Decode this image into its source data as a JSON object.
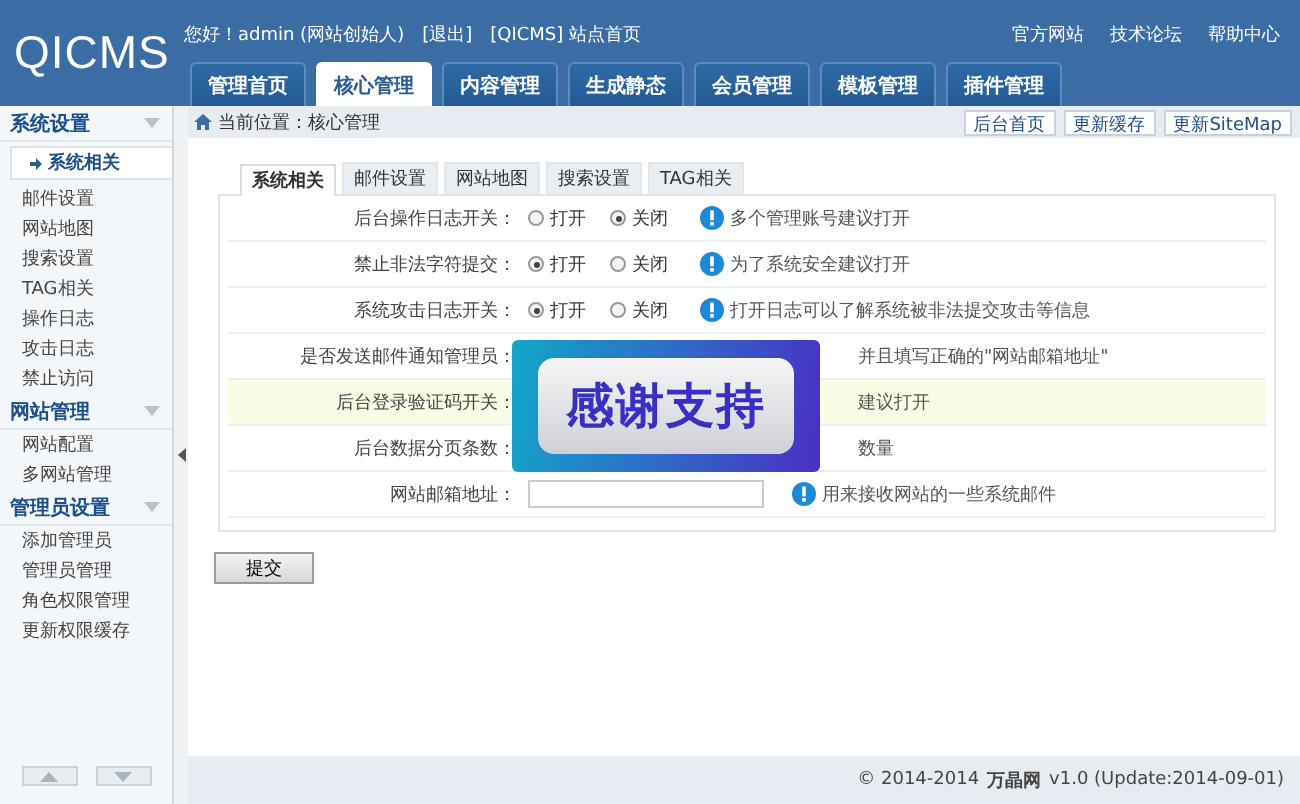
{
  "logo": "QICMS",
  "user_bar": {
    "greeting": "您好！admin (网站创始人)",
    "logout": "[退出]",
    "site_home": "[QICMS] 站点首页"
  },
  "top_links": [
    "官方网站",
    "技术论坛",
    "帮助中心"
  ],
  "nav_tabs": [
    {
      "label": "管理首页",
      "selected": false
    },
    {
      "label": "核心管理",
      "selected": true
    },
    {
      "label": "内容管理",
      "selected": false
    },
    {
      "label": "生成静态",
      "selected": false
    },
    {
      "label": "会员管理",
      "selected": false
    },
    {
      "label": "模板管理",
      "selected": false
    },
    {
      "label": "插件管理",
      "selected": false
    }
  ],
  "sidebar": {
    "sections": [
      {
        "title": "系统设置",
        "items": [
          {
            "label": "系统相关",
            "selected": true
          },
          {
            "label": "邮件设置",
            "selected": false
          },
          {
            "label": "网站地图",
            "selected": false
          },
          {
            "label": "搜索设置",
            "selected": false
          },
          {
            "label": "TAG相关",
            "selected": false
          },
          {
            "label": "操作日志",
            "selected": false
          },
          {
            "label": "攻击日志",
            "selected": false
          },
          {
            "label": "禁止访问",
            "selected": false
          }
        ]
      },
      {
        "title": "网站管理",
        "items": [
          {
            "label": "网站配置",
            "selected": false
          },
          {
            "label": "多网站管理",
            "selected": false
          }
        ]
      },
      {
        "title": "管理员设置",
        "items": [
          {
            "label": "添加管理员",
            "selected": false
          },
          {
            "label": "管理员管理",
            "selected": false
          },
          {
            "label": "角色权限管理",
            "selected": false
          },
          {
            "label": "更新权限缓存",
            "selected": false
          }
        ]
      }
    ]
  },
  "breadcrumb": "当前位置：核心管理",
  "actions": [
    "后台首页",
    "更新缓存",
    "更新SiteMap"
  ],
  "tabs": [
    {
      "label": "系统相关",
      "selected": true
    },
    {
      "label": "邮件设置",
      "selected": false
    },
    {
      "label": "网站地图",
      "selected": false
    },
    {
      "label": "搜索设置",
      "selected": false
    },
    {
      "label": "TAG相关",
      "selected": false
    }
  ],
  "rows": [
    {
      "kind": "radio",
      "label": "后台操作日志开关：",
      "options": [
        {
          "label": "打开",
          "selected": false
        },
        {
          "label": "关闭",
          "selected": true
        }
      ],
      "hint": "多个管理账号建议打开",
      "highlighted": false
    },
    {
      "kind": "radio",
      "label": "禁止非法字符提交：",
      "options": [
        {
          "label": "打开",
          "selected": true
        },
        {
          "label": "关闭",
          "selected": false
        }
      ],
      "hint": "为了系统安全建议打开",
      "highlighted": false
    },
    {
      "kind": "radio",
      "label": "系统攻击日志开关：",
      "options": [
        {
          "label": "打开",
          "selected": true
        },
        {
          "label": "关闭",
          "selected": false
        }
      ],
      "hint": "打开日志可以了解系统被非法提交攻击等信息",
      "highlighted": false
    },
    {
      "kind": "covered",
      "label": "是否发送邮件通知管理员：",
      "hint": "并且填写正确的\"网站邮箱地址\"",
      "highlighted": false
    },
    {
      "kind": "covered",
      "label": "后台登录验证码开关：",
      "hint": "建议打开",
      "highlighted": true
    },
    {
      "kind": "covered",
      "label": "后台数据分页条数：",
      "hint": "数量",
      "highlighted": false
    },
    {
      "kind": "input",
      "label": "网站邮箱地址：",
      "hint": "用来接收网站的一些系统邮件",
      "highlighted": false
    }
  ],
  "submit": "提交",
  "overlay": "感谢支持",
  "footer": {
    "copyright": "© 2014-2014",
    "brand": "万晶网",
    "version": "v1.0 (Update:2014-09-01)"
  }
}
